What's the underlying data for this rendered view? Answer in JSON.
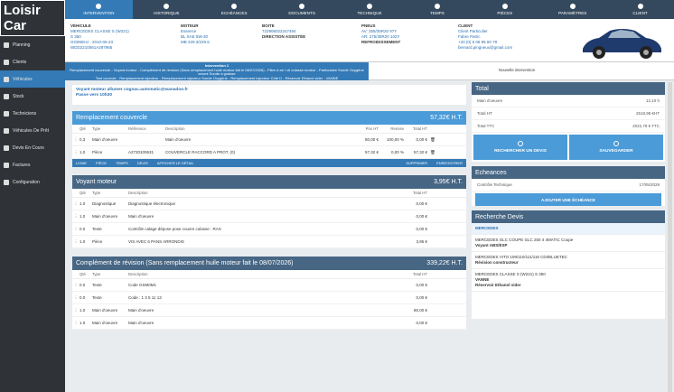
{
  "app": {
    "logo": "Loisir Car"
  },
  "nav": [
    {
      "label": "Planning",
      "icon": "calendar-icon",
      "active": false
    },
    {
      "label": "Clients",
      "icon": "users-icon",
      "active": false
    },
    {
      "label": "Véhicules",
      "icon": "car-icon",
      "active": true
    },
    {
      "label": "Stock",
      "icon": "box-icon",
      "active": false
    },
    {
      "label": "Techniciens",
      "icon": "wrench-icon",
      "active": false
    },
    {
      "label": "Véhicules De Prêt",
      "icon": "car-icon",
      "active": false
    },
    {
      "label": "Devis En Cours",
      "icon": "file-icon",
      "active": false
    },
    {
      "label": "Factures",
      "icon": "invoice-icon",
      "active": false
    },
    {
      "label": "Configuration",
      "icon": "gear-icon",
      "active": false
    }
  ],
  "tabs": [
    {
      "label": "Intervention",
      "icon": "tools-icon",
      "active": true
    },
    {
      "label": "Historique",
      "icon": "history-icon",
      "active": false
    },
    {
      "label": "Echéances",
      "icon": "calendar-icon",
      "active": false
    },
    {
      "label": "Documents",
      "icon": "document-icon",
      "active": false
    },
    {
      "label": "Technique",
      "icon": "database-icon",
      "active": false
    },
    {
      "label": "Temps",
      "icon": "clock-icon",
      "active": false
    },
    {
      "label": "Pièces",
      "icon": "parts-icon",
      "active": false
    },
    {
      "label": "Paramètres",
      "icon": "settings-icon",
      "active": false
    },
    {
      "label": "Client",
      "icon": "user-icon",
      "active": false
    }
  ],
  "vehicule": {
    "label": "VÉHICULE",
    "lines": [
      "MERCEDES CLASSE S (W221)",
      "S 350",
      "GG858HJ - 2010-06-23",
      "WDD2210561A287965"
    ]
  },
  "moteur": {
    "label": "MOTEUR",
    "lines": [
      "Essence",
      "BL SAE 5W-30",
      "MB 229.3/229.5"
    ]
  },
  "boite": {
    "label": "BOITE",
    "value": "722906022247484",
    "direction_label": "DIRECTION ASSISTÉE"
  },
  "pneus": {
    "label": "PNEUS",
    "lines": [
      "AV: 255/35R20 97Y",
      "AR: 275/35R20 102Y"
    ],
    "refroid_label": "REFROIDISSEMENT"
  },
  "client": {
    "label": "CLIENT",
    "lines": [
      "Client Particulier",
      "Fabre Patric",
      "+33 (0) 6 08 95 60 79",
      "bernard.pingneux@gmail.com"
    ]
  },
  "intervention": {
    "title": "Intervention 1",
    "text1": "Remplacement couvercle - Voyant moteur - Complément de révision (Sans remplacement huile moteur fait le 08/07/2026) - Filtre à air / ctl culasse moteur - Particulaire Sonde Oxygène amont Sonde à graisse",
    "text2": "Test courroie - Remplacement injecteur - Remplacement injecteur Sonde Oxygène - Remplacement injecteur Côté D - Réservoir Ethanol vider - VANNE",
    "new_label": "Nouvelle intervention"
  },
  "note": {
    "line1": "Voyant moteur allumer   cognac.automatic@wanadoo.fr",
    "line2": "Passe vers 10h30"
  },
  "headers": {
    "qte": "Qté",
    "type": "Type",
    "ref": "Référence",
    "desc": "Description",
    "prix": "Prix HT",
    "remise": "Remise",
    "total": "Total HT"
  },
  "blocks": [
    {
      "title": "Remplacement couvercle",
      "total": "57,32€ H.T.",
      "style": "blue",
      "hasRef": true,
      "rows": [
        {
          "qte": "0,3",
          "type": "Main d'oeuvre",
          "ref": "",
          "desc": "Main d'oeuvre",
          "prix": "80,00 €",
          "remise": "100,00 %",
          "total": "0,00 €"
        },
        {
          "qte": "1,0",
          "type": "Pièce",
          "ref": "A2720100631",
          "desc": "COUVERCLE RACCORD A PROT. (0)",
          "prix": "57,32 €",
          "remise": "0,00 %",
          "total": "57,32 €"
        }
      ],
      "toolbar": {
        "ligne": "LIGNE",
        "piece": "PIÈCE",
        "temps": "TEMPS",
        "devis": "DEVIS",
        "afficher": "AFFICHER LE DÉTAIL",
        "supprimer": "SUPPRIMER",
        "enregistrer": "ENREGISTRER"
      }
    },
    {
      "title": "Voyant moteur",
      "total": "3,95€ H.T.",
      "style": "dark",
      "hasRef": false,
      "rows": [
        {
          "qte": "1.0",
          "type": "Diagnostique",
          "desc": "Diagnostique électronique",
          "total": "0,00 €"
        },
        {
          "qte": "1.0",
          "type": "Main d'oeuvre",
          "desc": "Main d'oeuvre",
          "total": "0,00 €"
        },
        {
          "qte": "0.0",
          "type": "Texte",
          "desc": "Contrôle calage dépose pose couvre culasse : RAS",
          "total": "0,00 €"
        },
        {
          "qte": "1.0",
          "type": "Pièce",
          "desc": "VIS AVEC 6 PANS ARRONDIS",
          "total": "3,95 €"
        }
      ]
    },
    {
      "title": "Complément de révision (Sans remplacement huile moteur fait le 08/07/2026)",
      "total": "339,22€ H.T.",
      "style": "dark",
      "hasRef": false,
      "rows": [
        {
          "qte": "0.0",
          "type": "Texte",
          "desc": "Code GSM0M1",
          "total": "0,00 €"
        },
        {
          "qte": "0.0",
          "type": "Texte",
          "desc": "Code : 1 3 5 11 13",
          "total": "0,00 €"
        },
        {
          "qte": "1.0",
          "type": "Main d'oeuvre",
          "desc": "Main d'oeuvre",
          "total": "80,00 €"
        },
        {
          "qte": "1.0",
          "type": "Main d'oeuvre",
          "desc": "Main d'oeuvre",
          "total": "0,00 €"
        }
      ]
    }
  ],
  "total": {
    "title": "Total",
    "rows": [
      {
        "k": "Main d'oeuvre",
        "v": "12,10 h"
      },
      {
        "k": "Total HT",
        "v": "2518,98 €HT"
      },
      {
        "k": "Total TTC",
        "v": "2022,78 € TTC"
      }
    ],
    "btn1": "RECHERCHER UN DEVIS",
    "btn2": "SAUVEGARDER"
  },
  "echeances": {
    "title": "Echeances",
    "row": {
      "k": "Contrôle Technique",
      "v": "17/05/2028"
    },
    "btn": "AJOUTER UNE ÉCHÉANCE"
  },
  "recherche": {
    "title": "Recherche Devis",
    "header": "MERCEDES",
    "items": [
      {
        "l1": "MERCEDES GLC COUPE GLC 250 4 4MATIC Coupe",
        "l2": "Voyant ABS/ESP"
      },
      {
        "l1": "MERCEDES VITO 109/110/111/116 CDI/BLUETEC",
        "l2": "Révision constructeur"
      },
      {
        "l1": "MERCEDES CLASSE S (W221) S 350",
        "l2": "VANNE",
        "l3": "Réservoir Ethanol vider"
      }
    ]
  }
}
